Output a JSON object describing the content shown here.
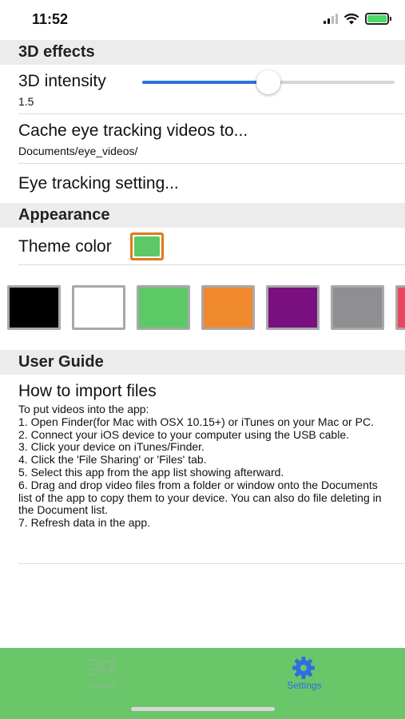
{
  "status": {
    "time": "11:52"
  },
  "sections": {
    "effects": "3D effects",
    "appearance": "Appearance",
    "guide": "User Guide"
  },
  "intensity": {
    "label": "3D intensity",
    "value_text": "1.5",
    "fraction": 0.5
  },
  "cache": {
    "label": "Cache eye tracking videos to...",
    "path": "Documents/eye_videos/"
  },
  "eye_tracking": {
    "label": "Eye tracking setting..."
  },
  "theme": {
    "label": "Theme color",
    "current": "#5cc966"
  },
  "palette": [
    "#000000",
    "#ffffff",
    "#5cc966",
    "#f0892e",
    "#7a0f80",
    "#8e8e93",
    "#e8475f"
  ],
  "guide": {
    "title": "How to import files",
    "body": "To put videos into the app:\n1. Open Finder(for Mac with OSX 10.15+) or iTunes on your Mac or PC.\n2. Connect your iOS device to your computer using the USB cable.\n3. Click your device on iTunes/Finder.\n4. Click the 'File Sharing' or 'Files' tab.\n5. Select this app from the app list showing afterward.\n6. Drag and drop video files from a folder or window onto the Documents list of the app to copy them to your device. You can also do file deleting in the Document list.\n7. Refresh data in the app."
  },
  "tabs": {
    "videos": "Videos",
    "settings": "Settings"
  },
  "colors": {
    "accent": "#2f6fe0",
    "tabbar": "#69c76a",
    "section_bg": "#ececec"
  }
}
